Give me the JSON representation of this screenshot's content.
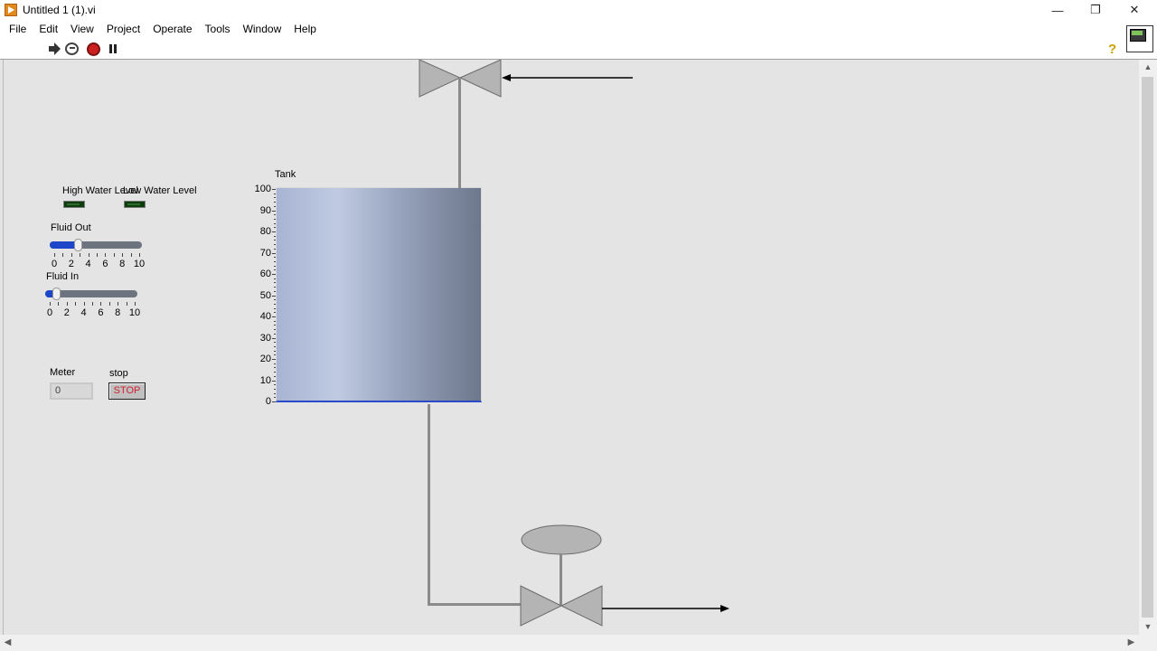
{
  "window": {
    "title": "Untitled 1 (1).vi",
    "minimize_glyph": "—",
    "restore_glyph": "❐",
    "close_glyph": "✕"
  },
  "menu": [
    "File",
    "Edit",
    "View",
    "Project",
    "Operate",
    "Tools",
    "Window",
    "Help"
  ],
  "toolbar": {
    "icons": [
      "run-arrow-icon",
      "run-continuously-icon",
      "abort-execution-icon",
      "pause-icon",
      "context-help-icon"
    ],
    "help_glyph": "?"
  },
  "panel": {
    "high_water_label": "High Water Level",
    "low_water_label": "Low Water Level",
    "fluid_out": {
      "label": "Fluid Out",
      "value": 2.9,
      "min": 0,
      "max": 10,
      "ticks": [
        "0",
        "2",
        "4",
        "6",
        "8",
        "10"
      ]
    },
    "fluid_in": {
      "label": "Fluid In",
      "value": 0.9,
      "min": 0,
      "max": 10,
      "ticks": [
        "0",
        "2",
        "4",
        "6",
        "8",
        "10"
      ]
    },
    "meter": {
      "label": "Meter",
      "value": "0"
    },
    "stop": {
      "label": "stop",
      "button_text": "STOP"
    },
    "tank": {
      "label": "Tank",
      "level": 0,
      "scale_max": 100,
      "ticks": [
        "100",
        "90",
        "80",
        "70",
        "60",
        "50",
        "40",
        "30",
        "20",
        "10",
        "0"
      ]
    }
  },
  "scrollbars": {
    "up": "▲",
    "down": "▼",
    "left": "◀",
    "right": "▶"
  },
  "colors": {
    "slider_fill": "#1e46c8",
    "stop_text": "#d02030",
    "led_off": "#0d3d0d",
    "valve_fill": "#b4b4b4"
  }
}
